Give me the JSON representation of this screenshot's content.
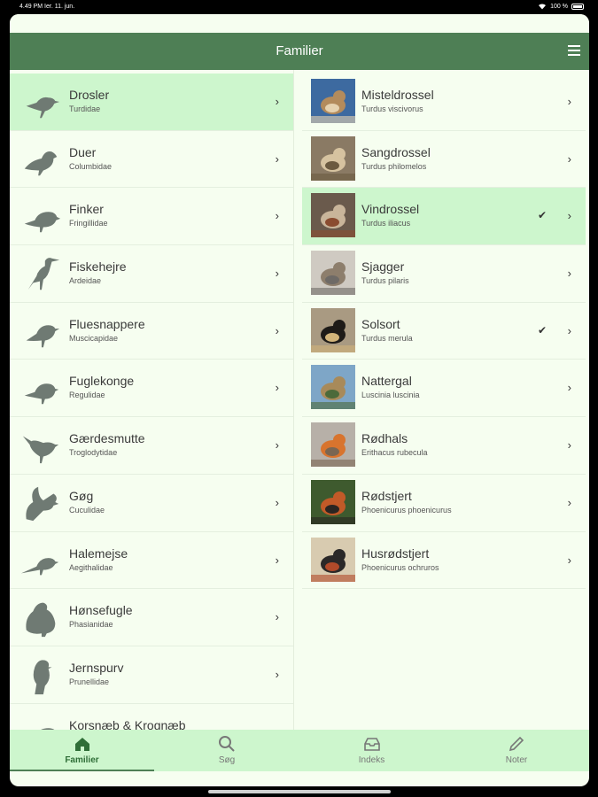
{
  "status": {
    "time": "4.49 PM",
    "date": "Ier. 11. jun.",
    "battery": "100 %"
  },
  "header": {
    "title": "Familier"
  },
  "families": [
    {
      "name": "Drosler",
      "latin": "Turdidae",
      "icon": "thrush-silhouette-icon"
    },
    {
      "name": "Duer",
      "latin": "Columbidae",
      "icon": "dove-silhouette-icon"
    },
    {
      "name": "Finker",
      "latin": "Fringillidae",
      "icon": "finch-silhouette-icon"
    },
    {
      "name": "Fiskehejre",
      "latin": "Ardeidae",
      "icon": "heron-silhouette-icon"
    },
    {
      "name": "Fluesnappere",
      "latin": "Muscicapidae",
      "icon": "flycatcher-silhouette-icon"
    },
    {
      "name": "Fuglekonge",
      "latin": "Regulidae",
      "icon": "goldcrest-silhouette-icon"
    },
    {
      "name": "Gærdesmutte",
      "latin": "Troglodytidae",
      "icon": "wren-silhouette-icon"
    },
    {
      "name": "Gøg",
      "latin": "Cuculidae",
      "icon": "cuckoo-silhouette-icon"
    },
    {
      "name": "Halemejse",
      "latin": "Aegithalidae",
      "icon": "tit-silhouette-icon"
    },
    {
      "name": "Hønsefugle",
      "latin": "Phasianidae",
      "icon": "partridge-silhouette-icon"
    },
    {
      "name": "Jernspurv",
      "latin": "Prunellidae",
      "icon": "dunnock-silhouette-icon"
    },
    {
      "name": "Korsnæb & Krognæb",
      "latin": "",
      "icon": "crossbill-silhouette-icon"
    }
  ],
  "species": [
    {
      "name": "Misteldrossel",
      "latin": "Turdus viscivorus",
      "checked": false,
      "colors": [
        "#3d6aa0",
        "#b38b5c",
        "#e6d2b0"
      ]
    },
    {
      "name": "Sangdrossel",
      "latin": "Turdus philomelos",
      "checked": false,
      "colors": [
        "#8a7a64",
        "#d6c3a0",
        "#6b5a40"
      ]
    },
    {
      "name": "Vindrossel",
      "latin": "Turdus iliacus",
      "checked": true,
      "colors": [
        "#6a5a4c",
        "#c9b59a",
        "#8a4c30"
      ]
    },
    {
      "name": "Sjagger",
      "latin": "Turdus pilaris",
      "checked": false,
      "colors": [
        "#cfcac2",
        "#8d7e6c",
        "#6e6a66"
      ]
    },
    {
      "name": "Solsort",
      "latin": "Turdus merula",
      "checked": true,
      "colors": [
        "#a99a82",
        "#1e1b18",
        "#d2b47a"
      ]
    },
    {
      "name": "Nattergal",
      "latin": "Luscinia luscinia",
      "checked": false,
      "colors": [
        "#7ea6c7",
        "#a88a5a",
        "#4c6a3a"
      ]
    },
    {
      "name": "Rødhals",
      "latin": "Erithacus rubecula",
      "checked": false,
      "colors": [
        "#b7b0a8",
        "#d8742e",
        "#7a6652"
      ]
    },
    {
      "name": "Rødstjert",
      "latin": "Phoenicurus phoenicurus",
      "checked": false,
      "colors": [
        "#3e5a2e",
        "#c25a28",
        "#2a2522"
      ]
    },
    {
      "name": "Husrødstjert",
      "latin": "Phoenicurus ochruros",
      "checked": false,
      "colors": [
        "#d8cbb0",
        "#2a2828",
        "#b04a2a"
      ]
    }
  ],
  "tabs": [
    {
      "label": "Familier",
      "icon": "home-icon",
      "active": true
    },
    {
      "label": "Søg",
      "icon": "search-icon",
      "active": false
    },
    {
      "label": "Indeks",
      "icon": "inbox-icon",
      "active": false
    },
    {
      "label": "Noter",
      "icon": "pencil-icon",
      "active": false
    }
  ],
  "colors": {
    "header": "#4e7f55",
    "selected": "#cdf6cd",
    "background": "#f6fef0"
  }
}
